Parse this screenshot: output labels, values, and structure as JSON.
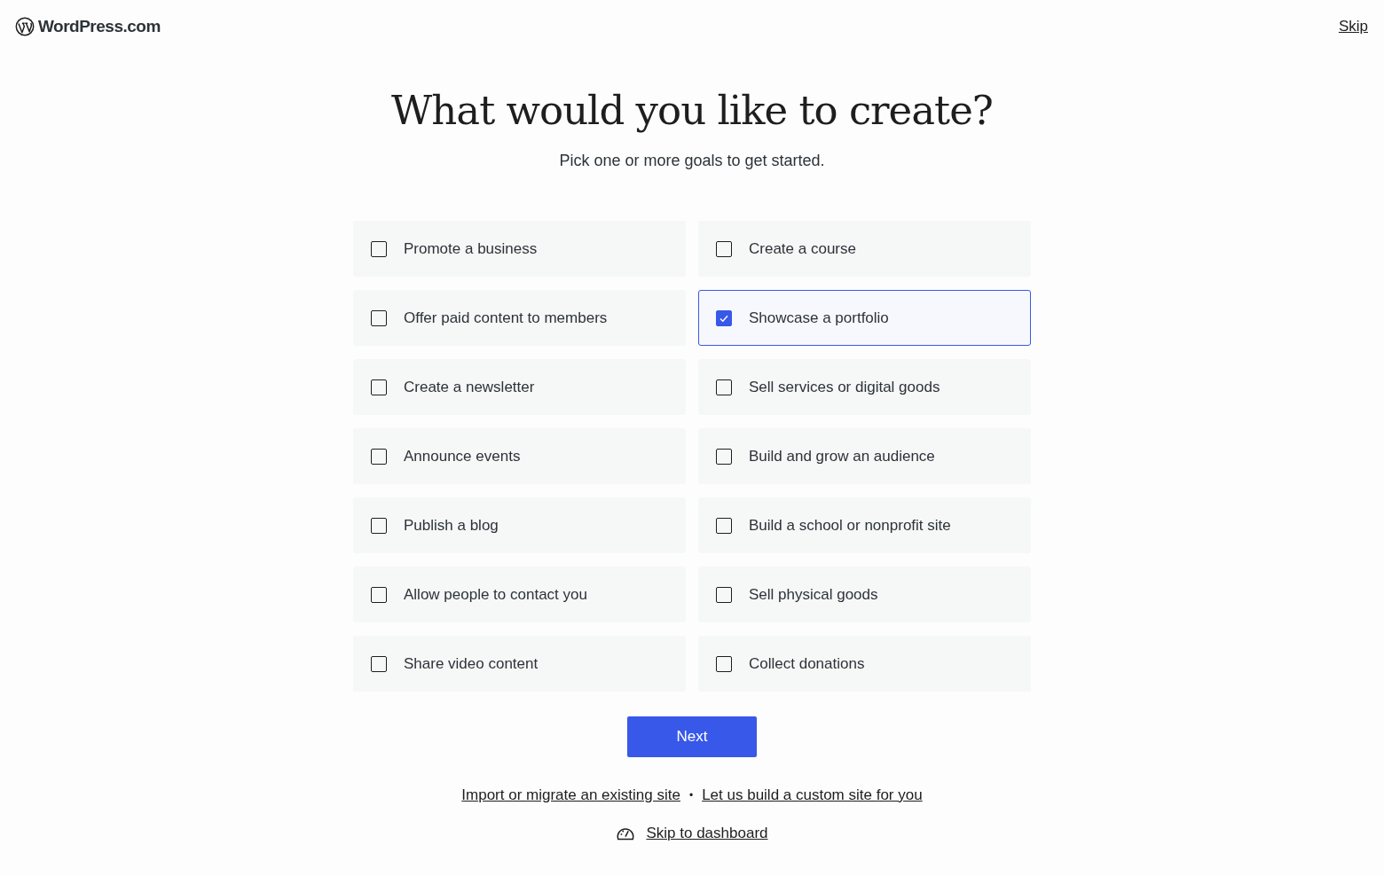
{
  "header": {
    "logo": "WordPress.com",
    "skip": "Skip"
  },
  "title": "What would you like to create?",
  "subtitle": "Pick one or more goals to get started.",
  "goals": [
    {
      "label": "Promote a business",
      "selected": false
    },
    {
      "label": "Create a course",
      "selected": false
    },
    {
      "label": "Offer paid content to members",
      "selected": false
    },
    {
      "label": "Showcase a portfolio",
      "selected": true
    },
    {
      "label": "Create a newsletter",
      "selected": false
    },
    {
      "label": "Sell services or digital goods",
      "selected": false
    },
    {
      "label": "Announce events",
      "selected": false
    },
    {
      "label": "Build and grow an audience",
      "selected": false
    },
    {
      "label": "Publish a blog",
      "selected": false
    },
    {
      "label": "Build a school or nonprofit site",
      "selected": false
    },
    {
      "label": "Allow people to contact you",
      "selected": false
    },
    {
      "label": "Sell physical goods",
      "selected": false
    },
    {
      "label": "Share video content",
      "selected": false
    },
    {
      "label": "Collect donations",
      "selected": false
    }
  ],
  "next_button": "Next",
  "links": [
    "Import or migrate an existing site",
    "Let us build a custom site for you"
  ],
  "separator": "•",
  "dashboard_link": "Skip to dashboard"
}
